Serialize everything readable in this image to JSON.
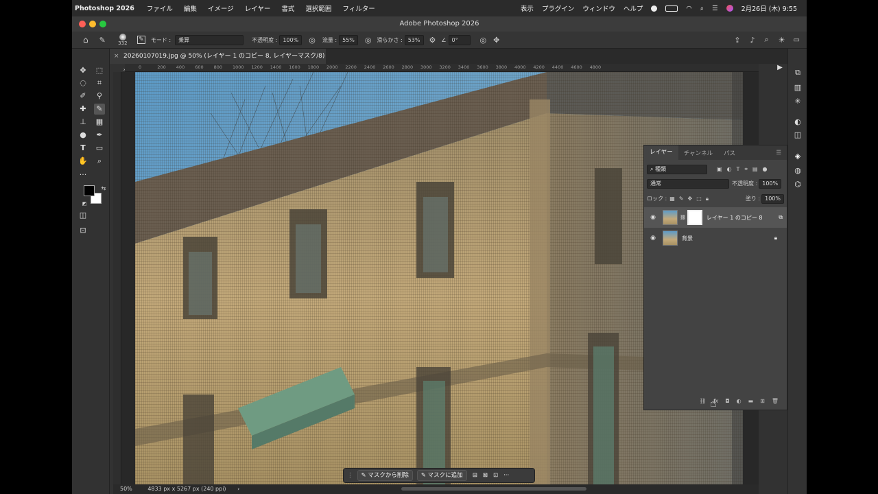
{
  "menubar": {
    "app_name": "Photoshop 2026",
    "items": [
      "ファイル",
      "編集",
      "イメージ",
      "レイヤー",
      "書式",
      "選択範囲",
      "フィルター"
    ],
    "right_items": [
      "表示",
      "プラグイン",
      "ウィンドウ",
      "ヘルプ"
    ],
    "datetime": "2月26日 (木) 9:55"
  },
  "window": {
    "title": "Adobe Photoshop 2026"
  },
  "options": {
    "brush_size": "332",
    "mode_label": "モード :",
    "mode_value": "乗算",
    "opacity_label": "不透明度 :",
    "opacity_value": "100%",
    "flow_label": "流量 :",
    "flow_value": "55%",
    "smoothing_label": "滑らかさ :",
    "smoothing_value": "53%",
    "angle_value": "0°"
  },
  "document": {
    "tab_title": "20260107019.jpg @ 50% (レイヤー 1 のコピー 8, レイヤーマスク/8) *",
    "ruler_marks": [
      "0",
      "200",
      "400",
      "600",
      "800",
      "1000",
      "1200",
      "1400",
      "1600",
      "1800",
      "2000",
      "2200",
      "2400",
      "2600",
      "2800",
      "3000",
      "3200",
      "3400",
      "3600",
      "3800",
      "4000",
      "4200",
      "4400",
      "4600",
      "4800"
    ]
  },
  "status": {
    "zoom": "50%",
    "info": "4833 px x 5267 px (240 ppi)"
  },
  "layers_panel": {
    "tabs": [
      "レイヤー",
      "チャンネル",
      "パス"
    ],
    "filter_kind": "種類",
    "blend_mode": "通常",
    "opacity_label": "不透明度 :",
    "opacity_value": "100%",
    "lock_label": "ロック :",
    "fill_label": "塗り :",
    "fill_value": "100%",
    "layers": [
      {
        "name": "レイヤー 1 のコピー 8",
        "visible": true
      },
      {
        "name": "背景",
        "visible": true,
        "locked": true
      }
    ]
  },
  "maskbar": {
    "remove_label": "マスクから削除",
    "add_label": "マスクに追加"
  },
  "colors": {
    "foreground": "#000000",
    "background": "#ffffff",
    "sky": "#4f8fbf"
  }
}
